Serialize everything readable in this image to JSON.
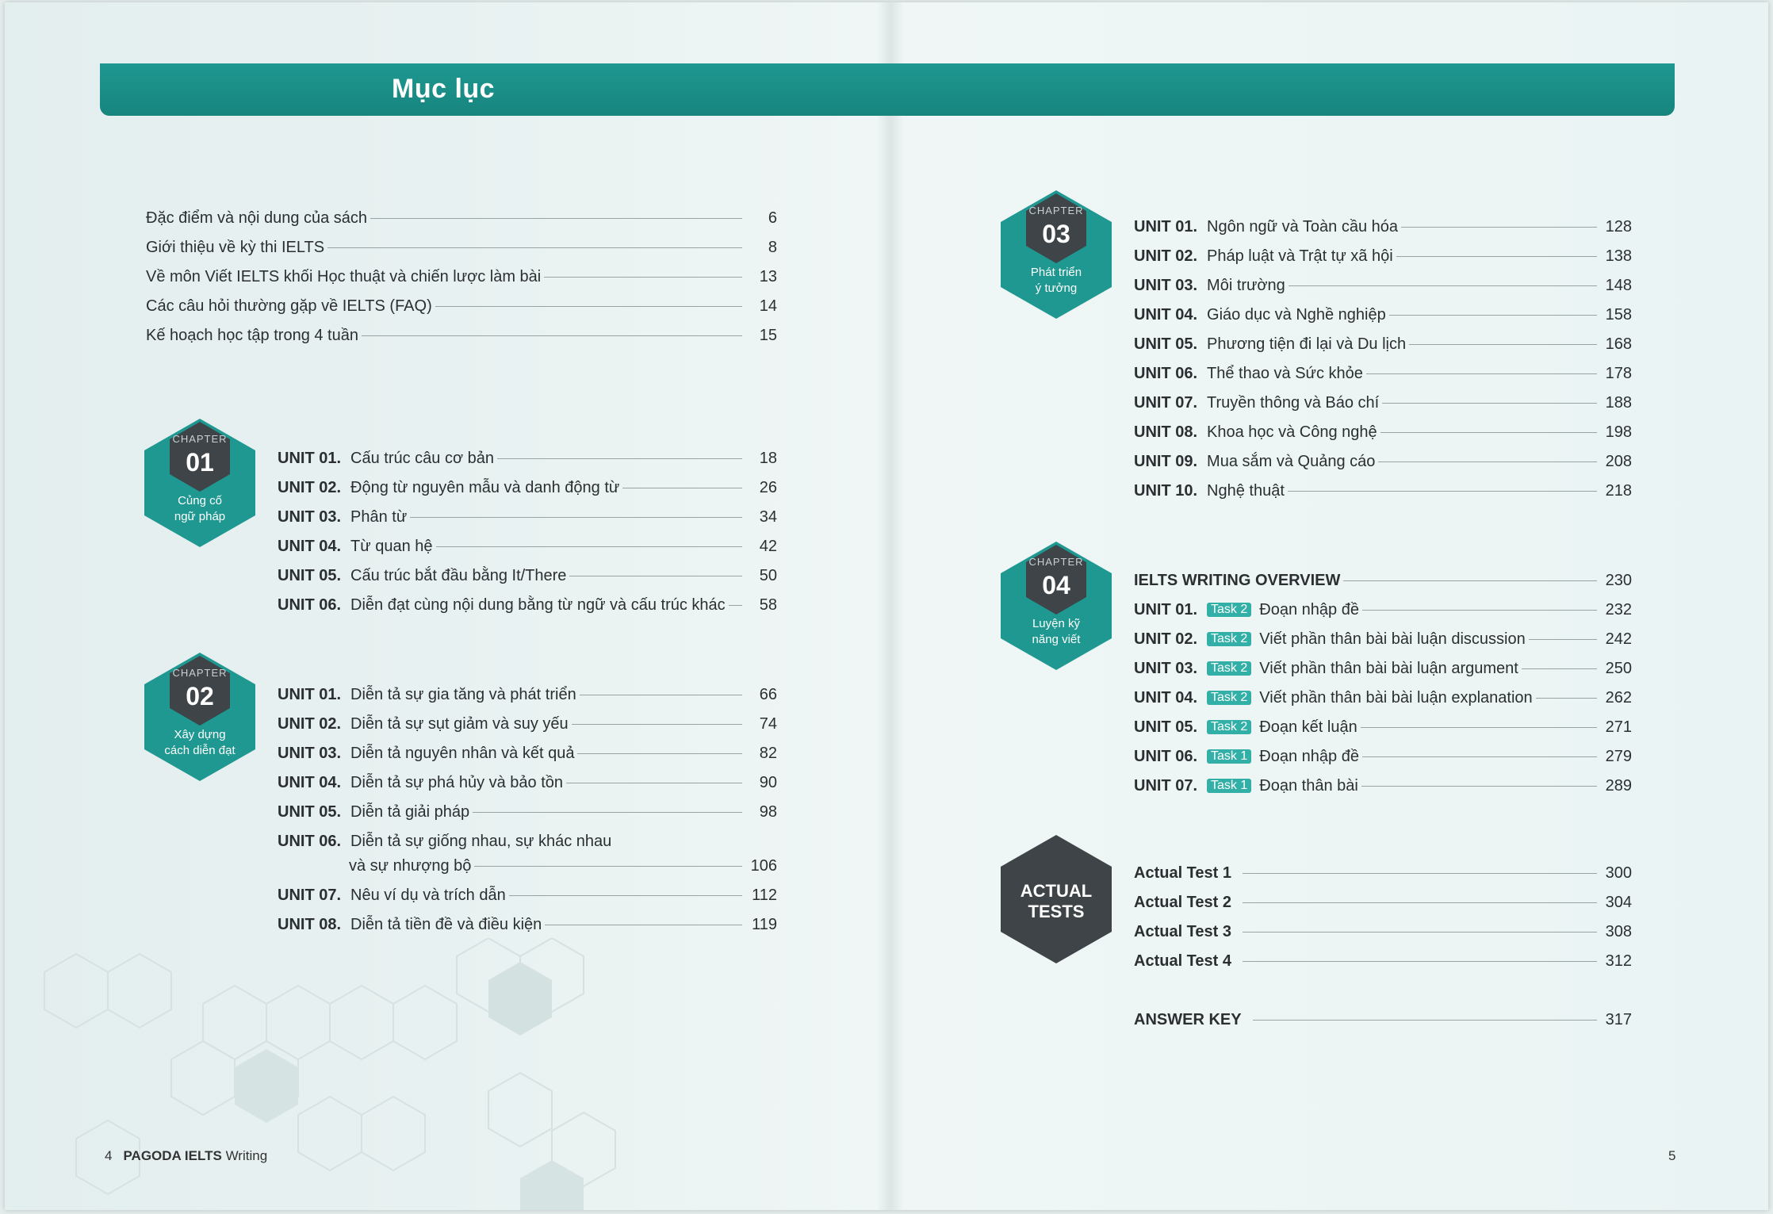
{
  "header": {
    "title": "Mục lục"
  },
  "intro": [
    {
      "title": "Đặc điểm và nội dung của sách",
      "page": "6"
    },
    {
      "title": "Giới thiệu về kỳ thi IELTS",
      "page": "8"
    },
    {
      "title": "Về môn Viết IELTS khối Học thuật và chiến lược làm bài",
      "page": "13"
    },
    {
      "title": "Các câu hỏi thường gặp về IELTS (FAQ)",
      "page": "14"
    },
    {
      "title": "Kế hoạch học tập trong 4 tuần",
      "page": "15"
    }
  ],
  "chapters": [
    {
      "label": "CHAPTER",
      "number": "01",
      "sub1": "Củng cố",
      "sub2": "ngữ pháp",
      "units": [
        {
          "unit": "UNIT 01.",
          "title": "Cấu trúc câu cơ bản",
          "page": "18"
        },
        {
          "unit": "UNIT 02.",
          "title": "Động từ nguyên mẫu và danh động từ",
          "page": "26"
        },
        {
          "unit": "UNIT 03.",
          "title": "Phân từ",
          "page": "34"
        },
        {
          "unit": "UNIT 04.",
          "title": "Từ quan hệ",
          "page": "42"
        },
        {
          "unit": "UNIT 05.",
          "title": "Cấu trúc bắt đầu bằng It/There",
          "page": "50"
        },
        {
          "unit": "UNIT 06.",
          "title": "Diễn đạt cùng nội dung bằng từ ngữ và cấu trúc khác",
          "page": "58"
        }
      ]
    },
    {
      "label": "CHAPTER",
      "number": "02",
      "sub1": "Xây dựng",
      "sub2": "cách diễn đạt",
      "units": [
        {
          "unit": "UNIT 01.",
          "title": "Diễn tả sự gia tăng và phát triển",
          "page": "66"
        },
        {
          "unit": "UNIT 02.",
          "title": "Diễn tả sự sụt giảm và suy yếu",
          "page": "74"
        },
        {
          "unit": "UNIT 03.",
          "title": "Diễn tả nguyên nhân và kết quả",
          "page": "82"
        },
        {
          "unit": "UNIT 04.",
          "title": "Diễn tả sự phá hủy và bảo tồn",
          "page": "90"
        },
        {
          "unit": "UNIT 05.",
          "title": "Diễn tả giải pháp",
          "page": "98"
        },
        {
          "unit": "UNIT 06.",
          "title": "Diễn tả sự giống nhau, sự khác nhau",
          "title2": "và sự nhượng bộ",
          "page": "106"
        },
        {
          "unit": "UNIT 07.",
          "title": "Nêu ví dụ và trích dẫn",
          "page": "112"
        },
        {
          "unit": "UNIT 08.",
          "title": "Diễn tả tiền đề và điều kiện",
          "page": "119"
        }
      ]
    },
    {
      "label": "CHAPTER",
      "number": "03",
      "sub1": "Phát triển",
      "sub2": "ý tưởng",
      "units": [
        {
          "unit": "UNIT 01.",
          "title": "Ngôn ngữ và Toàn cầu hóa",
          "page": "128"
        },
        {
          "unit": "UNIT 02.",
          "title": "Pháp luật và Trật tự xã hội",
          "page": "138"
        },
        {
          "unit": "UNIT 03.",
          "title": "Môi trường",
          "page": "148"
        },
        {
          "unit": "UNIT 04.",
          "title": "Giáo dục và Nghề nghiệp",
          "page": "158"
        },
        {
          "unit": "UNIT 05.",
          "title": "Phương tiện đi lại và Du lịch",
          "page": "168"
        },
        {
          "unit": "UNIT 06.",
          "title": "Thể thao và Sức khỏe",
          "page": "178"
        },
        {
          "unit": "UNIT 07.",
          "title": "Truyền thông và Báo chí",
          "page": "188"
        },
        {
          "unit": "UNIT 08.",
          "title": "Khoa học và Công nghệ",
          "page": "198"
        },
        {
          "unit": "UNIT 09.",
          "title": "Mua sắm và Quảng cáo",
          "page": "208"
        },
        {
          "unit": "UNIT 10.",
          "title": "Nghệ thuật",
          "page": "218"
        }
      ]
    },
    {
      "label": "CHAPTER",
      "number": "04",
      "sub1": "Luyện kỹ",
      "sub2": "năng viết",
      "overview": {
        "title": "IELTS WRITING OVERVIEW",
        "page": "230"
      },
      "units": [
        {
          "unit": "UNIT 01.",
          "task": "Task 2",
          "title": "Đoạn nhập đề",
          "page": "232"
        },
        {
          "unit": "UNIT 02.",
          "task": "Task 2",
          "title": "Viết phần thân bài bài luận discussion",
          "page": "242"
        },
        {
          "unit": "UNIT 03.",
          "task": "Task 2",
          "title": "Viết phần thân bài bài luận argument",
          "page": "250"
        },
        {
          "unit": "UNIT 04.",
          "task": "Task 2",
          "title": "Viết phần thân bài bài luận explanation",
          "page": "262"
        },
        {
          "unit": "UNIT 05.",
          "task": "Task 2",
          "title": "Đoạn kết luận",
          "page": "271"
        },
        {
          "unit": "UNIT 06.",
          "task": "Task 1",
          "title": "Đoạn nhập đề",
          "page": "279"
        },
        {
          "unit": "UNIT 07.",
          "task": "Task 1",
          "title": "Đoạn thân bài",
          "page": "289"
        }
      ]
    }
  ],
  "actual_tests": {
    "line1": "ACTUAL",
    "line2": "TESTS",
    "items": [
      {
        "title": "Actual Test 1",
        "page": "300"
      },
      {
        "title": "Actual Test 2",
        "page": "304"
      },
      {
        "title": "Actual Test 3",
        "page": "308"
      },
      {
        "title": "Actual Test 4",
        "page": "312"
      }
    ]
  },
  "answer_key": {
    "title": "ANSWER KEY",
    "page": "317"
  },
  "footer": {
    "left_page": "4",
    "book_brand": "PAGODA IELTS",
    "book_subject": "Writing",
    "right_page": "5"
  },
  "colors": {
    "teal": "#1e9891",
    "hex_dark": "#3e4447",
    "task_badge": "#32b0a7"
  }
}
